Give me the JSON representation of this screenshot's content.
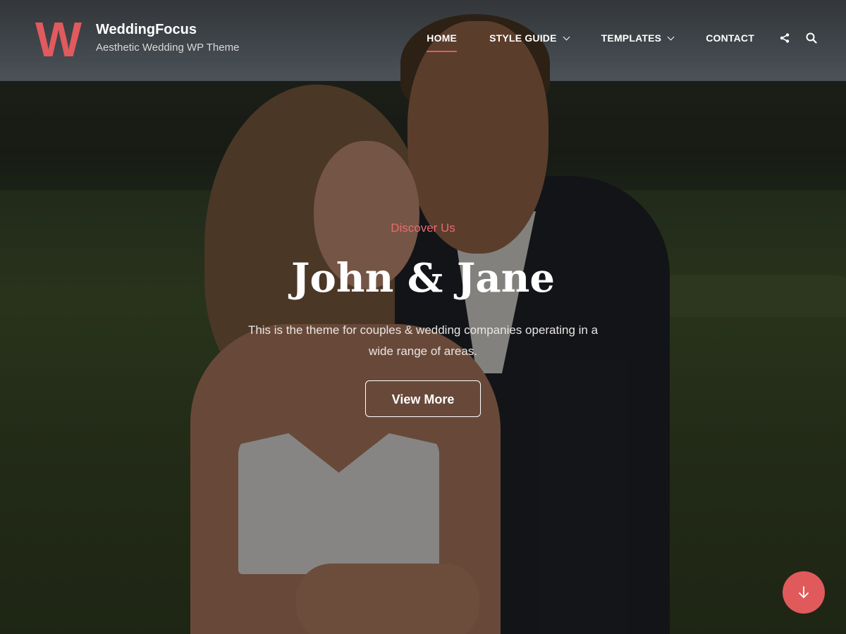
{
  "site": {
    "logo_letter": "W",
    "title": "WeddingFocus",
    "tagline": "Aesthetic Wedding WP Theme"
  },
  "nav": {
    "items": [
      {
        "label": "HOME",
        "active": true,
        "dropdown": false
      },
      {
        "label": "STYLE GUIDE",
        "active": false,
        "dropdown": true
      },
      {
        "label": "TEMPLATES",
        "active": false,
        "dropdown": true
      },
      {
        "label": "CONTACT",
        "active": false,
        "dropdown": false
      }
    ],
    "icons": [
      "share-icon",
      "search-icon"
    ]
  },
  "hero": {
    "eyebrow": "Discover Us",
    "title": "John & Jane",
    "description": "This is the theme for couples & wedding companies operating in a wide range of areas.",
    "button_label": "View More"
  },
  "scroll_button": {
    "icon": "arrow-down-icon"
  },
  "colors": {
    "accent": "#e15a5e",
    "text_on_image": "#ffffff"
  }
}
